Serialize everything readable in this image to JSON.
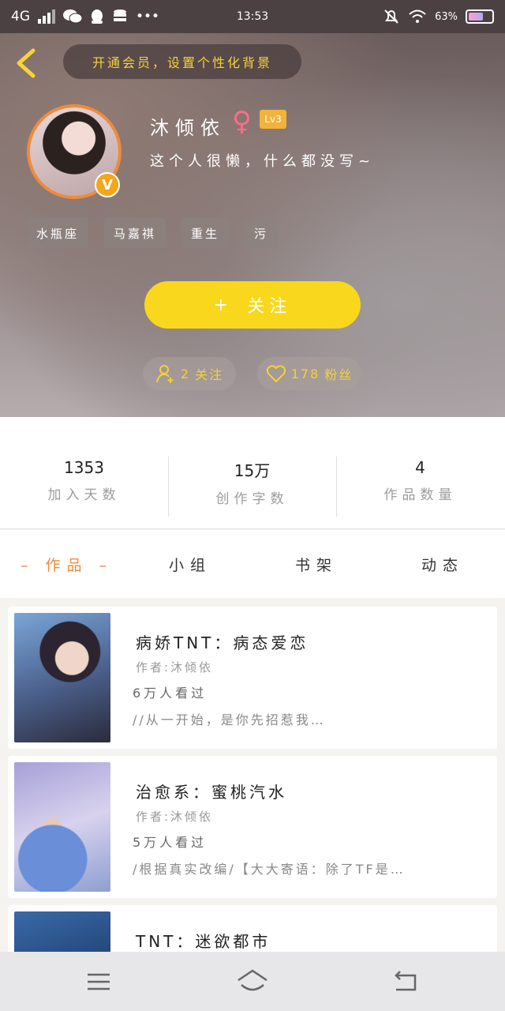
{
  "status_bar": {
    "network": "4G",
    "time": "13:53",
    "battery": "63%",
    "battery_level": 0.63
  },
  "header": {
    "vip_banner": "开通会员，设置个性化背景"
  },
  "profile": {
    "name": "沐倾依",
    "level": "Lv3",
    "verified_badge": "V",
    "bio": "这个人很懒，什么都没写~",
    "tags": [
      "水瓶座",
      "马嘉祺",
      "重生",
      "污"
    ]
  },
  "actions": {
    "follow_label": "关注",
    "follows_count": "2",
    "follows_label": "关注",
    "fans_count": "178",
    "fans_label": "粉丝"
  },
  "stats": [
    {
      "value": "1353",
      "label": "加入天数"
    },
    {
      "value": "15万",
      "label": "创作字数"
    },
    {
      "value": "4",
      "label": "作品数量"
    }
  ],
  "tabs": [
    "作品",
    "小组",
    "书架",
    "动态"
  ],
  "works": [
    {
      "title": "病娇TNT：病态爱恋",
      "author": "作者:沐倾依",
      "views": "6万人看过",
      "intro": "//从一开始，是你先招惹我…"
    },
    {
      "title": "治愈系：蜜桃汽水",
      "author": "作者:沐倾依",
      "views": "5万人看过",
      "intro": "/根据真实改编/【大大寄语：除了TF是…"
    },
    {
      "title": "TNT：迷欲都市",
      "author": "",
      "views": "",
      "intro": ""
    }
  ],
  "colors": {
    "accent": "#f08a3c",
    "follow_button": "#f9d71c",
    "fans_text": "#f5d232"
  }
}
